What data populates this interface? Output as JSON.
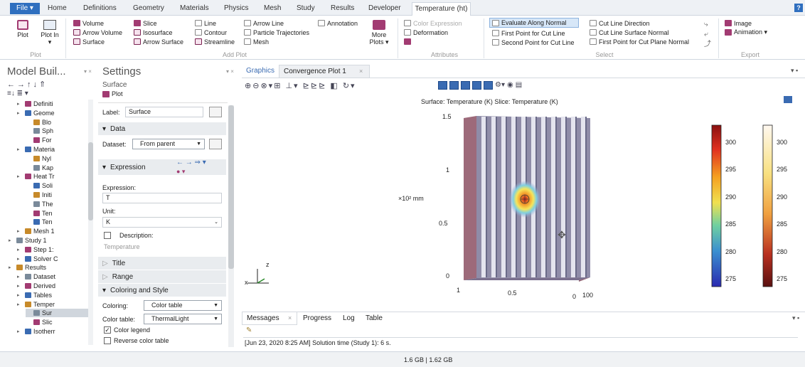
{
  "tabs": {
    "file": "File ▾",
    "items": [
      "Home",
      "Definitions",
      "Geometry",
      "Materials",
      "Physics",
      "Mesh",
      "Study",
      "Results",
      "Developer"
    ],
    "active": "Temperature (ht)"
  },
  "ribbon": {
    "plot": {
      "plot_label": "Plot",
      "plot_in_label": "Plot In ▾",
      "group": "Plot"
    },
    "add_plot": {
      "col1": [
        "Volume",
        "Arrow Volume",
        "Surface"
      ],
      "col2": [
        "Slice",
        "Isosurface",
        "Arrow Surface"
      ],
      "col3": [
        "Line",
        "Contour",
        "Streamline"
      ],
      "col4": [
        "Arrow Line",
        "Particle Trajectories",
        "Mesh"
      ],
      "col5": [
        "Annotation"
      ],
      "more": "More Plots ▾",
      "group": "Add Plot"
    },
    "attributes": {
      "items": [
        "Color Expression",
        "Deformation"
      ],
      "group": "Attributes"
    },
    "select": {
      "col1": [
        "Evaluate Along Normal",
        "First Point for Cut Line",
        "Second Point for Cut Line"
      ],
      "col2": [
        "Cut Line Direction",
        "Cut Line Surface Normal",
        "First Point for Cut Plane Normal"
      ],
      "group": "Select"
    },
    "export": {
      "items": [
        "Image",
        "Animation ▾"
      ],
      "group": "Export"
    }
  },
  "model_builder": {
    "title": "Model Buil...",
    "tree": [
      {
        "label": "Definiti",
        "indent": 1
      },
      {
        "label": "Geome",
        "indent": 1
      },
      {
        "label": "Blo",
        "indent": 2
      },
      {
        "label": "Sph",
        "indent": 2
      },
      {
        "label": "For",
        "indent": 2
      },
      {
        "label": "Materia",
        "indent": 1
      },
      {
        "label": "Nyl",
        "indent": 2
      },
      {
        "label": "Kap",
        "indent": 2
      },
      {
        "label": "Heat Tr",
        "indent": 1
      },
      {
        "label": "Soli",
        "indent": 2
      },
      {
        "label": "Initi",
        "indent": 2
      },
      {
        "label": "The",
        "indent": 2
      },
      {
        "label": "Ten",
        "indent": 2
      },
      {
        "label": "Ten",
        "indent": 2
      },
      {
        "label": "Mesh 1",
        "indent": 1
      },
      {
        "label": "Study 1",
        "indent": 0
      },
      {
        "label": "Step 1:",
        "indent": 1
      },
      {
        "label": "Solver C",
        "indent": 1
      },
      {
        "label": "Results",
        "indent": 0
      },
      {
        "label": "Dataset",
        "indent": 1
      },
      {
        "label": "Derived",
        "indent": 1
      },
      {
        "label": "Tables",
        "indent": 1
      },
      {
        "label": "Temper",
        "indent": 1
      },
      {
        "label": "Sur",
        "indent": 2
      },
      {
        "label": "Slic",
        "indent": 2
      },
      {
        "label": "Isotherr",
        "indent": 1
      }
    ]
  },
  "settings": {
    "title": "Settings",
    "subtitle": "Surface",
    "plot_btn": "Plot",
    "label_lbl": "Label:",
    "label_val": "Surface",
    "data_section": "Data",
    "dataset_lbl": "Dataset:",
    "dataset_val": "From parent",
    "expression_section": "Expression",
    "expression_lbl": "Expression:",
    "expression_val": "T",
    "unit_lbl": "Unit:",
    "unit_val": "K",
    "description_lbl": "Description:",
    "description_val": "Temperature",
    "title_section": "Title",
    "range_section": "Range",
    "coloring_section": "Coloring and Style",
    "coloring_lbl": "Coloring:",
    "coloring_val": "Color table",
    "colortable_lbl": "Color table:",
    "colortable_val": "ThermalLight",
    "color_legend": "Color legend",
    "reverse": "Reverse color table"
  },
  "graphics": {
    "tabs": [
      "Graphics",
      "Convergence Plot 1"
    ],
    "plot_title": "Surface: Temperature (K)  Slice: Temperature (K)",
    "yticks": [
      "1.5",
      "1",
      "0.5",
      "0"
    ],
    "unit_label": "×10² mm",
    "bottom_ticks": [
      "1",
      "0.5",
      "0",
      "100"
    ],
    "axis_z": "z",
    "axis_x": "x",
    "legend1": [
      "300",
      "295",
      "290",
      "285",
      "280",
      "275"
    ],
    "legend2": [
      "300",
      "295",
      "290",
      "285",
      "280",
      "275"
    ]
  },
  "messages": {
    "tabs": [
      "Messages",
      "Progress",
      "Log",
      "Table"
    ],
    "text": "[Jun 23, 2020 8:25 AM] Solution time (Study 1): 6 s."
  },
  "status": {
    "memory": "1.6 GB | 1.62 GB"
  }
}
